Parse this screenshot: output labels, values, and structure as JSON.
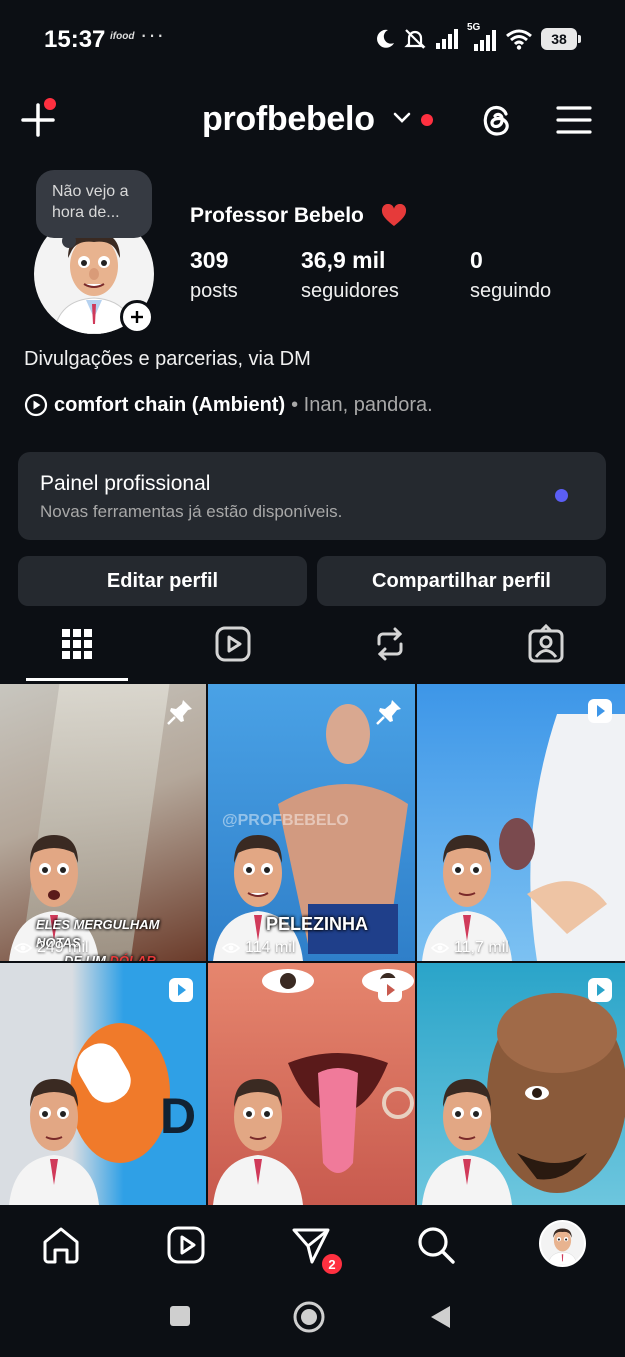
{
  "status_bar": {
    "time": "15:37",
    "small_note": "ifood",
    "more": "···",
    "network": "5G",
    "battery": "38"
  },
  "header": {
    "username": "profbebelo",
    "icons": [
      "plus-icon",
      "chevron-down-icon",
      "threads-icon",
      "menu-icon"
    ]
  },
  "profile": {
    "note": "Não vejo a hora de...",
    "full_name": "Professor Bebelo",
    "stats": [
      {
        "value": "309",
        "label": "posts"
      },
      {
        "value": "36,9 mil",
        "label": "seguidores"
      },
      {
        "value": "0",
        "label": "seguindo"
      }
    ],
    "bio": "Divulgações e parcerias, via DM",
    "music": {
      "song": "comfort chain (Ambient)",
      "artists": "• Inan, pandora."
    }
  },
  "pro_dashboard": {
    "title": "Painel profissional",
    "subtitle": "Novas ferramentas já estão disponíveis."
  },
  "buttons": {
    "edit": "Editar perfil",
    "share": "Compartilhar perfil"
  },
  "tabs": [
    "grid-icon",
    "reels-icon",
    "reposts-icon",
    "tagged-icon"
  ],
  "grid": [
    {
      "type": "pinned",
      "views": "249 mil",
      "caption_line1": "ELES MERGULHAM NOTAS",
      "caption_line2": "DE UM ",
      "caption_highlight": "DÓLAR",
      "bg": "#8a6b5a"
    },
    {
      "type": "pinned",
      "views": "114 mil",
      "caption_line1": "PELEZINHA",
      "watermark": "@PROFBEBELO",
      "bg": "#3a8fd8"
    },
    {
      "type": "reel",
      "views": "11,7 mil",
      "bg": "#3b93e6"
    },
    {
      "type": "reel",
      "bg": "#e07a3a"
    },
    {
      "type": "reel",
      "bg": "#e8806c"
    },
    {
      "type": "reel",
      "bg": "#2aa4c9"
    }
  ],
  "bottom_nav": {
    "icons": [
      "home-icon",
      "reels-icon",
      "direct-icon",
      "search-icon",
      "profile-avatar"
    ],
    "direct_badge": "2"
  },
  "colors": {
    "background": "#0c0f14",
    "card": "#25292f",
    "accent_red": "#ff3040",
    "accent_blue": "#5b5ef5"
  }
}
